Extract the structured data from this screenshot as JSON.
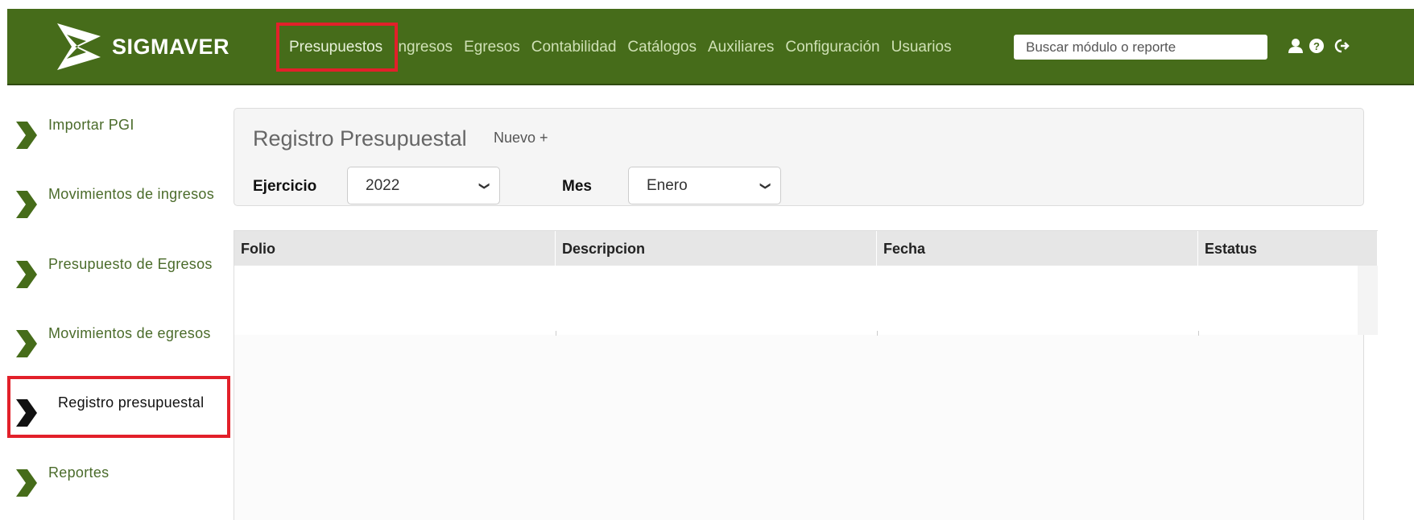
{
  "app": {
    "name": "SIGMAVER"
  },
  "nav": {
    "items": [
      {
        "label": "Presupuestos",
        "active": true
      },
      {
        "label": "Ingresos"
      },
      {
        "label": "Egresos"
      },
      {
        "label": "Contabilidad"
      },
      {
        "label": "Catálogos"
      },
      {
        "label": "Auxiliares"
      },
      {
        "label": "Configuración"
      },
      {
        "label": "Usuarios"
      }
    ]
  },
  "search": {
    "placeholder": "Buscar módulo o reporte",
    "value": ""
  },
  "header_icons": [
    "user-icon",
    "help-icon",
    "logout-icon"
  ],
  "sidebar": {
    "items": [
      {
        "label": "Importar PGI"
      },
      {
        "label": "Movimientos de ingresos"
      },
      {
        "label": "Presupuesto de Egresos"
      },
      {
        "label": "Movimientos de egresos"
      },
      {
        "label": "Registro presupuestal",
        "active": true
      },
      {
        "label": "Reportes"
      }
    ]
  },
  "panel": {
    "title": "Registro Presupuestal",
    "new_label": "Nuevo +",
    "ejercicio_label": "Ejercicio",
    "ejercicio_value": "2022",
    "mes_label": "Mes",
    "mes_value": "Enero"
  },
  "table": {
    "columns": [
      "Folio",
      "Descripcion",
      "Fecha",
      "Estatus"
    ],
    "rows": []
  },
  "colors": {
    "header_bg": "#466c1a",
    "nav_text": "#cfe0b5",
    "highlight": "#e2202a",
    "sidebar_text": "#4a6b2a"
  }
}
